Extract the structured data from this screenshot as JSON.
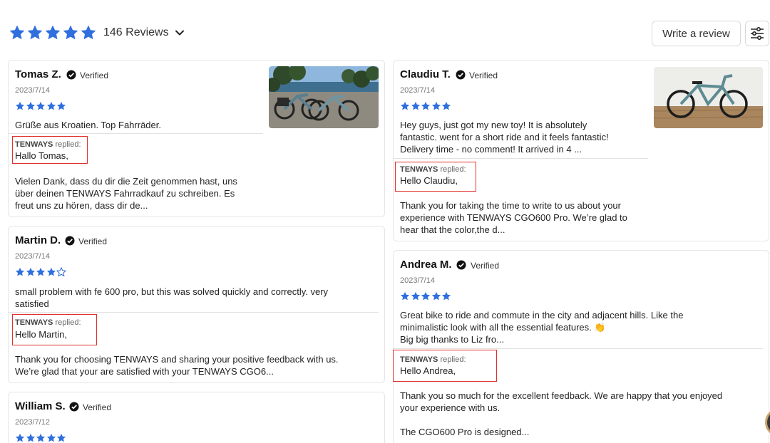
{
  "summary": {
    "reviews_label": "146 Reviews",
    "rating_stars": 5,
    "star_color": "#2f6fde"
  },
  "actions": {
    "write_review": "Write a review"
  },
  "verified_label": "Verified",
  "reply_prefix": "TENWAYS",
  "reply_suffix": "replied:",
  "reviews": [
    {
      "name": "Tomas Z.",
      "date": "2023/7/14",
      "rating": 5,
      "lines": [
        "Grüße aus Kroatien. Top Fahrräder."
      ],
      "reply_hello": "Hallo Tomas,",
      "reply_lines": [
        "Vielen Dank, dass du dir die Zeit genommen hast, uns",
        "über deinen TENWAYS Fahrradkauf zu schreiben. Es",
        "freut uns zu hören, dass dir de..."
      ]
    },
    {
      "name": "Martin D.",
      "date": "2023/7/14",
      "rating": 4,
      "lines": [
        "small problem with fe 600 pro, but this was solved quickly and correctly.  very",
        "satisfied"
      ],
      "reply_hello": "Hello Martin,",
      "reply_lines": [
        "Thank you for choosing TENWAYS and sharing your positive feedback with us.",
        "We’re glad that your are satisfied with your TENWAYS CGO6..."
      ]
    },
    {
      "name": "William S.",
      "date": "2023/7/12",
      "rating": 5
    },
    {
      "name": "Claudiu T.",
      "date": "2023/7/14",
      "rating": 5,
      "lines": [
        "Hey guys, just got my new toy! It is absolutely",
        "fantastic. went for a short ride and it feels fantastic!",
        "Delivery time - no comment! It arrived in 4 ..."
      ],
      "reply_hello": "Hello Claudiu,",
      "reply_lines": [
        "Thank you for taking the time to write to us about your",
        "experience with TENWAYS CGO600 Pro. We’re glad to",
        "hear that the color,the d..."
      ]
    },
    {
      "name": "Andrea M.",
      "date": "2023/7/14",
      "rating": 5,
      "lines": [
        "Great bike to ride and commute in the city and adjacent hills. Like the",
        "minimalistic look with all the essential features. 👏",
        "Big big thanks to Liz fro..."
      ],
      "reply_hello": "Hello Andrea,",
      "reply_lines": [
        "Thank you so much for the excellent feedback. We are happy that you enjoyed",
        "your experience with us.",
        "",
        "The CGO600 Pro is designed..."
      ]
    }
  ]
}
